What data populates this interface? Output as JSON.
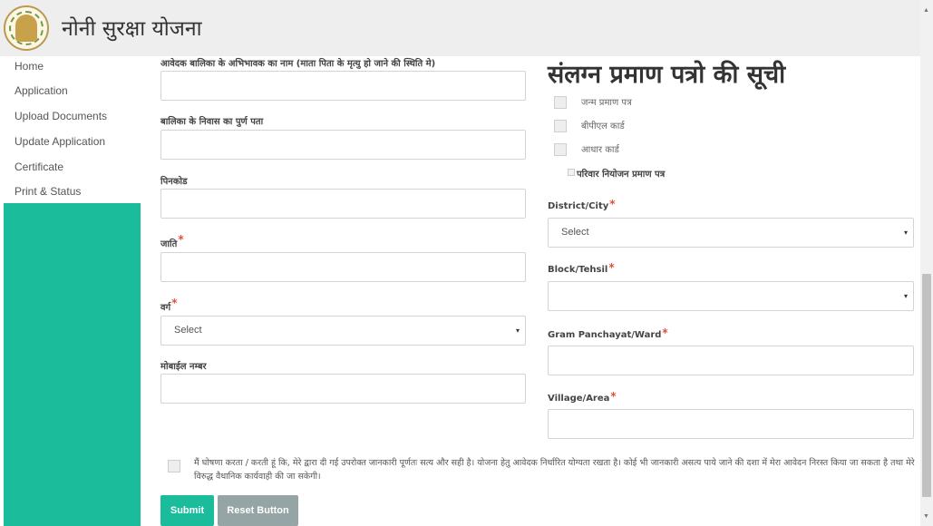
{
  "header": {
    "brand": "नोनी सुरक्षा योजना"
  },
  "sidebar": {
    "items": [
      {
        "label": "Home"
      },
      {
        "label": "Application"
      },
      {
        "label": "Upload Documents"
      },
      {
        "label": "Update Application"
      },
      {
        "label": "Certificate"
      },
      {
        "label": "Print & Status"
      }
    ]
  },
  "form_left": {
    "guardian_label": "आवेदक बालिका के अभिभावक का नाम (माता पिता के मृत्यु हो जाने की स्थिति मे)",
    "address_label": "बालिका के निवास का पुर्ण पता",
    "pincode_label": "पिनकोड",
    "caste_label": "जाति",
    "category_label": "वर्ग",
    "category_selected": "Select",
    "mobile_label": "मोबाईल नम्बर"
  },
  "form_right": {
    "docs_title": "संलग्न प्रमाण पत्रो की सूची",
    "docs": [
      {
        "label": "जन्म प्रमाण पत्र"
      },
      {
        "label": "बीपीएल कार्ड"
      },
      {
        "label": "आधार कार्ड"
      }
    ],
    "family_planning_label": "परिवार नियोजन प्रमाण पत्र",
    "district_label": "District/City",
    "district_selected": "Select",
    "block_label": "Block/Tehsil",
    "block_selected": "",
    "gram_label": "Gram Panchayat/Ward",
    "village_label": "Village/Area"
  },
  "required_mark": "*",
  "declaration": "मैं घोषणा करता / करती हूं कि, मेरे द्वारा दी गई उपरोक्त जानकारी पूर्णतः सत्य और सही है। योजना हेतु आवेदक निर्धारित योग्यता रखता है। कोई भी जानकारी असत्य पाये जाने की दशा में मेरा आवेदन निरस्त किया जा सकता है तथा मेरे विरुद्ध वैधानिक कार्यवाही की जा सकेगी।",
  "buttons": {
    "submit": "Submit",
    "reset": "Reset Button"
  },
  "icons": {
    "select_arrow": "▾",
    "scroll_up": "▲",
    "scroll_down": "▼"
  },
  "colors": {
    "accent": "#1abc9c",
    "reset": "#95a5a6",
    "required": "#e74c3c"
  }
}
